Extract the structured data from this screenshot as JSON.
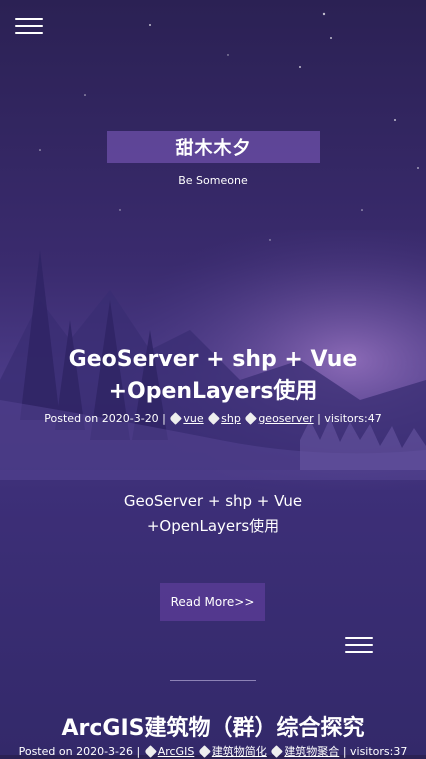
{
  "header": {
    "menu_icon": "hamburger-menu-icon",
    "brand_title": "甜木木夕",
    "subtitle": "Be Someone"
  },
  "posts": [
    {
      "title": "GeoServer + shp + Vue +OpenLayers使用",
      "posted_label": "Posted on 2020-3-20 |",
      "tags": [
        "vue",
        "shp",
        "geoserver"
      ],
      "visitors": "| visitors:47",
      "excerpt": "GeoServer + shp + Vue +OpenLayers使用",
      "read_more": "Read More>>"
    },
    {
      "title": "ArcGIS建筑物（群）综合探究",
      "posted_label": "Posted on 2020-3-26 |",
      "tags": [
        "ArcGIS",
        "建筑物简化",
        "建筑物聚合"
      ],
      "visitors": "| visitors:37"
    }
  ],
  "colors": {
    "background_top": "#2b2154",
    "background_mid": "#4a3a86",
    "accent_box": "#6e50aa"
  }
}
